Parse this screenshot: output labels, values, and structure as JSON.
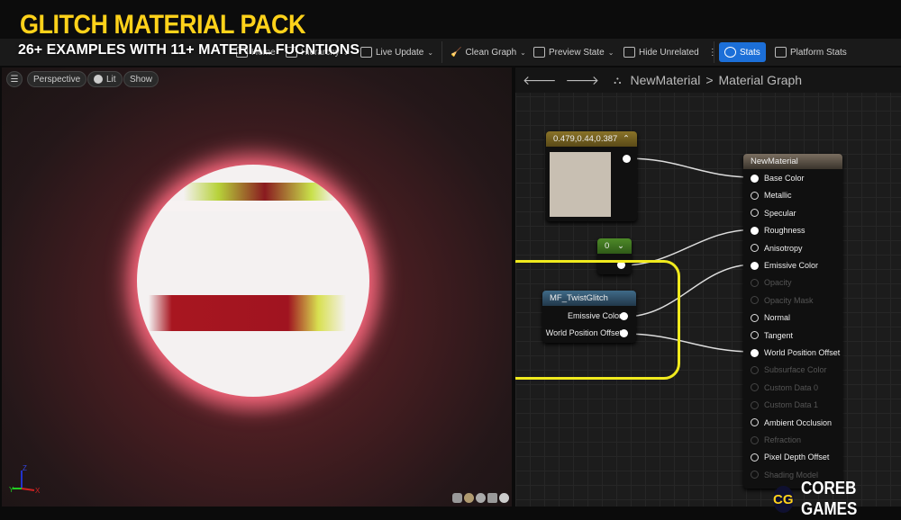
{
  "overlay": {
    "title": "GLITCH MATERIAL PACK",
    "subtitle": "26+ EXAMPLES WITH 11+ MATERIAL FUCNTIONS"
  },
  "toolbar": {
    "home": "Home",
    "hierarchy": "Hierarchy",
    "live_update": "Live Update",
    "clean_graph": "Clean Graph",
    "preview_state": "Preview State",
    "hide_unrelated": "Hide Unrelated",
    "stats": "Stats",
    "platform_stats": "Platform Stats",
    "stats_active_color": "#1c6fd8"
  },
  "viewport": {
    "perspective": "Perspective",
    "lit": "Lit",
    "show": "Show",
    "axis": {
      "x": "X",
      "y": "Y",
      "z": "Z"
    },
    "preview_shapes": [
      "cylinder",
      "sphere",
      "plane",
      "cube",
      "custom-mesh"
    ]
  },
  "graph": {
    "breadcrumb": {
      "root": "NewMaterial",
      "separator": ">",
      "current": "Material Graph"
    },
    "constant3": {
      "value": "0.479,0.44,0.387",
      "swatch": "#c8bfb2",
      "header_color": "#7a6420"
    },
    "constant": {
      "value": "0",
      "header_color": "#3f6b20"
    },
    "function_node": {
      "title": "MF_TwistGlitch",
      "outputs": [
        "Emissive Color",
        "World Position Offset"
      ],
      "header_color": "#2f4f66",
      "highlight_color": "#f0ea1e"
    },
    "material_node": {
      "title": "NewMaterial",
      "inputs": [
        {
          "label": "Base Color",
          "state": "connected"
        },
        {
          "label": "Metallic",
          "state": "enabled"
        },
        {
          "label": "Specular",
          "state": "enabled"
        },
        {
          "label": "Roughness",
          "state": "connected"
        },
        {
          "label": "Anisotropy",
          "state": "enabled"
        },
        {
          "label": "Emissive Color",
          "state": "connected"
        },
        {
          "label": "Opacity",
          "state": "disabled"
        },
        {
          "label": "Opacity Mask",
          "state": "disabled"
        },
        {
          "label": "Normal",
          "state": "enabled"
        },
        {
          "label": "Tangent",
          "state": "enabled"
        },
        {
          "label": "World Position Offset",
          "state": "connected"
        },
        {
          "label": "Subsurface Color",
          "state": "disabled"
        },
        {
          "label": "Custom Data 0",
          "state": "disabled"
        },
        {
          "label": "Custom Data 1",
          "state": "disabled"
        },
        {
          "label": "Ambient Occlusion",
          "state": "enabled"
        },
        {
          "label": "Refraction",
          "state": "disabled"
        },
        {
          "label": "Pixel Depth Offset",
          "state": "enabled"
        },
        {
          "label": "Shading Model",
          "state": "disabled"
        }
      ]
    },
    "connections": [
      {
        "from": "constant3.out",
        "to": "Base Color"
      },
      {
        "from": "constant.out",
        "to": "Roughness"
      },
      {
        "from": "MF_TwistGlitch.Emissive Color",
        "to": "Emissive Color"
      },
      {
        "from": "MF_TwistGlitch.World Position Offset",
        "to": "World Position Offset"
      }
    ]
  },
  "branding": {
    "badge": "CG",
    "name": "COREB GAMES"
  }
}
